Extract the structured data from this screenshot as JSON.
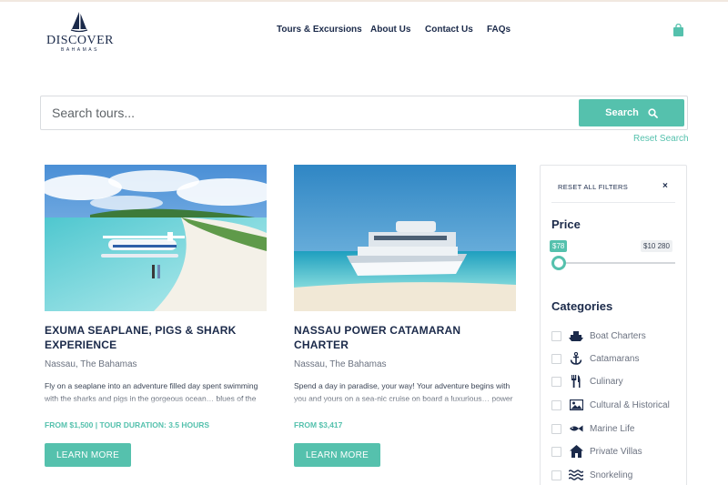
{
  "header": {
    "logo_main": "DISCOVER",
    "logo_sub": "BAHAMAS",
    "nav": [
      "Tours & Excursions",
      "About Us",
      "Contact Us",
      "FAQs"
    ],
    "cart_icon": "shopping-bag-icon"
  },
  "search": {
    "placeholder": "Search tours...",
    "button_label": "Search",
    "button_icon": "search-icon",
    "reset_label": "Reset Search"
  },
  "tours": [
    {
      "title": "EXUMA SEAPLANE, PIGS & SHARK EXPERIENCE",
      "location": "Nassau, The Bahamas",
      "description": "Fly on a seaplane into an adventure filled day spent swimming with the sharks and pigs in the gorgeous ocean… blues of the Exuma Cays.",
      "meta": "FROM $1,500 | TOUR DURATION: 3.5 HOURS",
      "button": "LEARN MORE"
    },
    {
      "title": "NASSAU POWER CATAMARAN CHARTER",
      "location": "Nassau, The Bahamas",
      "description": "Spend a day in paradise, your way! Your adventure begins with you and yours on a sea-nic cruise on board a luxurious… power catamaran.",
      "meta": "FROM $3,417",
      "button": "LEARN MORE"
    }
  ],
  "filters": {
    "reset_all": "RESET ALL FILTERS",
    "close": "×",
    "price_heading": "Price",
    "price_min": "$78",
    "price_max": "$10 280",
    "categories_heading": "Categories",
    "categories": [
      {
        "label": "Boat Charters",
        "icon": "ship-icon"
      },
      {
        "label": "Catamarans",
        "icon": "anchor-icon"
      },
      {
        "label": "Culinary",
        "icon": "utensils-icon"
      },
      {
        "label": "Cultural & Historical",
        "icon": "image-icon"
      },
      {
        "label": "Marine Life",
        "icon": "fish-icon"
      },
      {
        "label": "Private Villas",
        "icon": "house-icon"
      },
      {
        "label": "Snorkeling",
        "icon": "water-icon"
      }
    ]
  },
  "colors": {
    "accent": "#55c1ad",
    "navy": "#1b2a4a"
  }
}
